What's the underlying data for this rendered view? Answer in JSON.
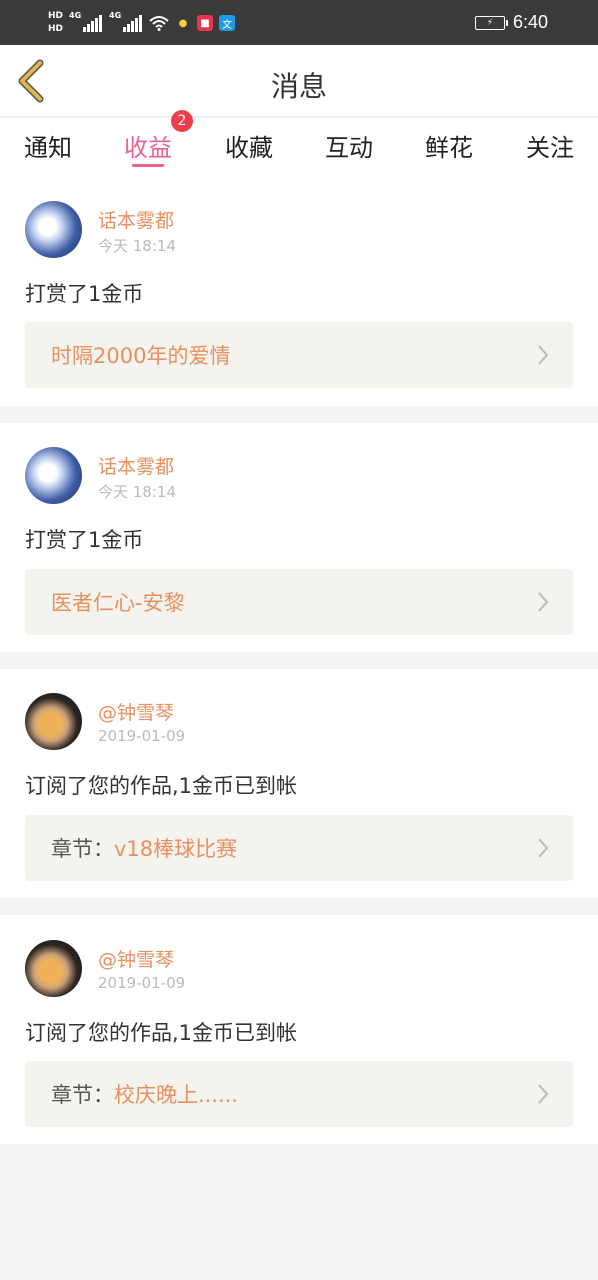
{
  "status_bar": {
    "hd1": "HD",
    "hd2": "HD",
    "net1": "4G",
    "net2": "4G",
    "time": "6:40"
  },
  "header": {
    "title": "消息"
  },
  "tabs": [
    {
      "label": "通知"
    },
    {
      "label": "收益",
      "badge": "2"
    },
    {
      "label": "收藏"
    },
    {
      "label": "互动"
    },
    {
      "label": "鲜花"
    },
    {
      "label": "关注"
    }
  ],
  "messages": [
    {
      "user": "话本雾都",
      "time": "今天 18:14",
      "text": "打赏了1金币",
      "link_prefix": "",
      "link": "时隔2000年的爱情"
    },
    {
      "user": "话本雾都",
      "time": "今天 18:14",
      "text": "打赏了1金币",
      "link_prefix": "",
      "link": "医者仁心-安黎"
    },
    {
      "user": "@钟雪琴",
      "time": "2019-01-09",
      "text": "订阅了您的作品,1金币已到帐",
      "link_prefix": "章节：",
      "link": "v18棒球比赛"
    },
    {
      "user": "@钟雪琴",
      "time": "2019-01-09",
      "text": "订阅了您的作品,1金币已到帐",
      "link_prefix": "章节：",
      "link": "校庆晚上......"
    }
  ],
  "colors": {
    "accent": "#e9638a",
    "badge": "#ef3d4a",
    "username": "#e89060",
    "link_bg": "#f4f3ee",
    "back_arrow": "#e3b64a"
  }
}
